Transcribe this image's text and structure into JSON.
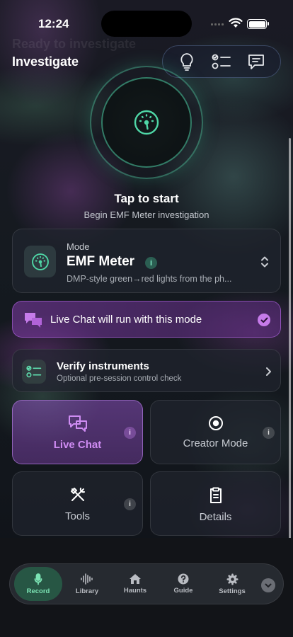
{
  "status_bar": {
    "time": "12:24"
  },
  "header": {
    "ghost_title": "Ready to investigate",
    "title": "Investigate"
  },
  "top_actions": [
    "lightbulb-icon",
    "checklist-icon",
    "chat-icon"
  ],
  "start": {
    "title": "Tap to start",
    "subtitle": "Begin EMF Meter investigation"
  },
  "mode_card": {
    "label": "Mode",
    "name": "EMF Meter",
    "info": "i",
    "description": "DMP-style green→red lights from the ph..."
  },
  "live_chat_banner": {
    "text": "Live Chat will run with this mode",
    "checked": true
  },
  "verify": {
    "title": "Verify instruments",
    "subtitle": "Optional pre-session control check"
  },
  "tiles": {
    "live_chat": "Live Chat",
    "creator_mode": "Creator Mode",
    "tools": "Tools",
    "details": "Details",
    "info": "i"
  },
  "tabbar": {
    "record": "Record",
    "library": "Library",
    "haunts": "Haunts",
    "guide": "Guide",
    "settings": "Settings"
  },
  "colors": {
    "accent_green": "#4fd8a7",
    "accent_purple": "#c67bea",
    "background": "#12161c"
  }
}
